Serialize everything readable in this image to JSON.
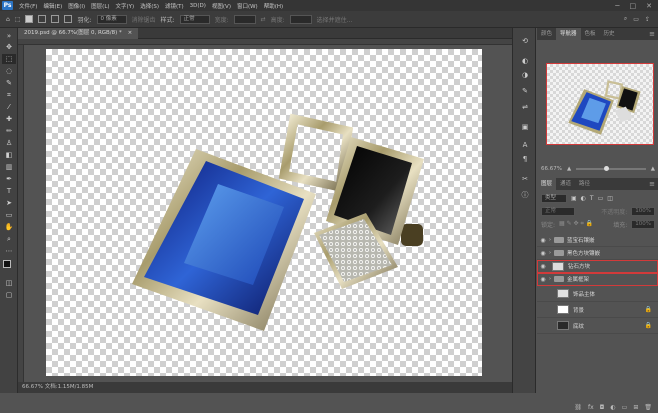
{
  "app": {
    "logo": "Ps"
  },
  "menu": {
    "items": [
      "文件(F)",
      "编辑(E)",
      "图像(I)",
      "图层(L)",
      "文字(Y)",
      "选择(S)",
      "滤镜(T)",
      "3D(D)",
      "视图(V)",
      "窗口(W)",
      "帮助(H)"
    ]
  },
  "window": {
    "min": "─",
    "max": "□",
    "close": "✕"
  },
  "options": {
    "mode_label": "羽化:",
    "feather_value": "0 像素",
    "antialias": "消除锯齿",
    "style_label": "样式:",
    "style_value": "正常",
    "width_label": "宽度:",
    "height_label": "高度:",
    "select_mask": "选择并遮住..."
  },
  "document": {
    "tab": "2019.psd @ 66.7%(图层 0, RGB/8) *",
    "close": "×"
  },
  "status": {
    "text": "66.67%    文档:1.15M/1.85M"
  },
  "panels": {
    "top_tabs": [
      "颜色",
      "导航器",
      "色板",
      "历史"
    ],
    "active_top": 1,
    "nav_zoom": "66.67%",
    "layer_tabs": [
      "图层",
      "通道",
      "路径"
    ],
    "active_layer_tab": 0
  },
  "layers": {
    "filter_label": "类型",
    "blend_mode": "正常",
    "opacity_label": "不透明度:",
    "opacity_value": "100%",
    "lock_label": "锁定:",
    "fill_label": "填充:",
    "fill_value": "100%",
    "rows": [
      {
        "name": "蓝宝石镶嵌",
        "type": "group",
        "visible": true
      },
      {
        "name": "黑色方块镶嵌",
        "type": "group",
        "visible": true
      },
      {
        "name": "钻石方块",
        "type": "layer",
        "visible": true
      },
      {
        "name": "金属框架",
        "type": "group",
        "visible": true
      },
      {
        "name": "饰品主体",
        "type": "layer",
        "visible": false
      },
      {
        "name": "背景",
        "type": "layer",
        "visible": false
      },
      {
        "name": "底纹",
        "type": "layer",
        "visible": false
      }
    ]
  },
  "colors": {
    "highlight": "#d23a3a",
    "accent": "#2b74c4"
  }
}
